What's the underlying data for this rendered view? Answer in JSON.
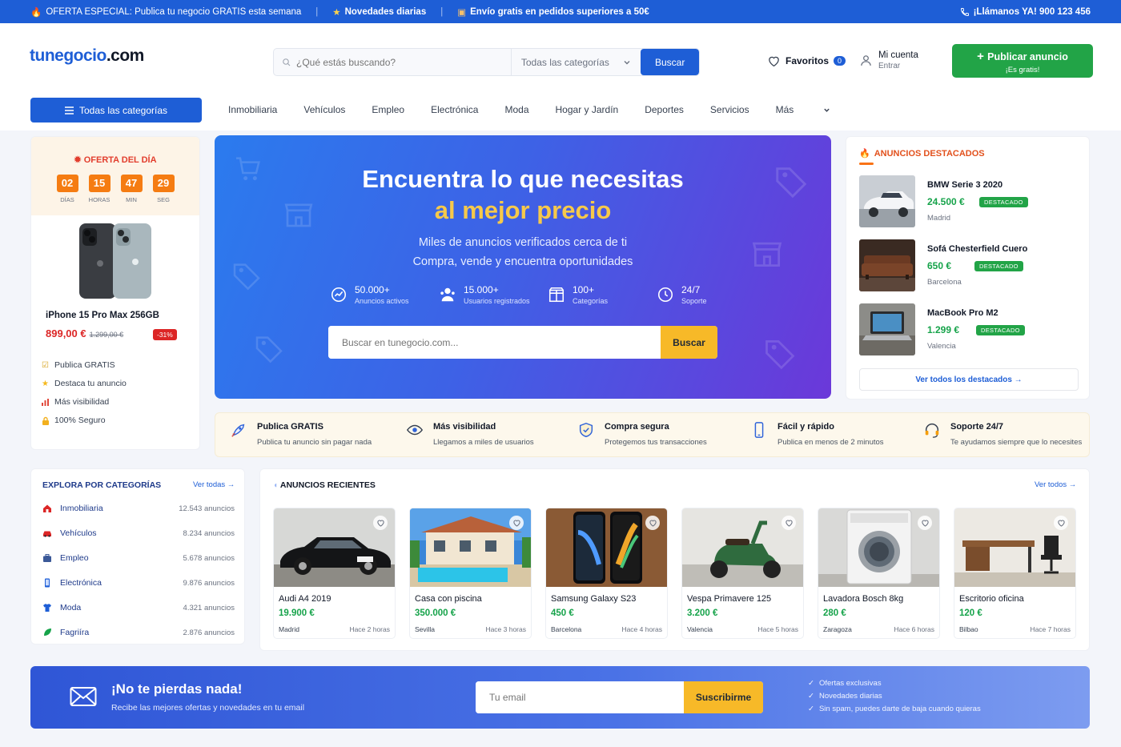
{
  "topbar": {
    "offer": "OFERTA ESPECIAL: Publica tu negocio GRATIS esta semana",
    "news": "Novedades diarias",
    "shipping": "Envío gratis en pedidos superiores a 50€",
    "phone": "¡Llámanos YA! 900 123 456"
  },
  "header": {
    "logo_main": "tunegocio",
    "logo_tld": ".com",
    "search_placeholder": "¿Qué estás buscando?",
    "category_select": "Todas las categorías",
    "search_button": "Buscar",
    "favorites_label": "Favoritos",
    "favorites_count": "0",
    "account_label": "Mi cuenta",
    "account_sub": "Entrar",
    "publish_label": "Publicar anuncio",
    "publish_sub": "¡Es gratis!"
  },
  "nav": {
    "all_categories": "Todas las categorías",
    "items": [
      "Inmobiliaria",
      "Vehículos",
      "Empleo",
      "Electrónica",
      "Moda",
      "Hogar y Jardín",
      "Deportes",
      "Servicios",
      "Más"
    ]
  },
  "deal": {
    "title": "OFERTA DEL DÍA",
    "countdown": [
      {
        "value": "02",
        "unit": "DÍAS"
      },
      {
        "value": "15",
        "unit": "HORAS"
      },
      {
        "value": "47",
        "unit": "MIN"
      },
      {
        "value": "29",
        "unit": "SEG"
      }
    ],
    "product": "iPhone 15 Pro Max 256GB",
    "price": "899,00 €",
    "old_price": "1.299,00 €",
    "discount": "-31%",
    "features": [
      "Publica GRATIS",
      "Destaca tu anuncio",
      "Más visibilidad",
      "100% Seguro"
    ]
  },
  "hero": {
    "title_line1": "Encuentra lo que necesitas",
    "title_line2": "al mejor precio",
    "subtitle1": "Miles de anuncios verificados cerca de ti",
    "subtitle2": "Compra, vende y encuentra oportunidades",
    "stats": [
      {
        "value": "50.000+",
        "label": "Anuncios activos",
        "icon": "chart-icon"
      },
      {
        "value": "15.000+",
        "label": "Usuarios registrados",
        "icon": "users-icon"
      },
      {
        "value": "100+",
        "label": "Categorías",
        "icon": "box-icon"
      },
      {
        "value": "24/7",
        "label": "Soporte",
        "icon": "clock-icon"
      }
    ],
    "search_placeholder": "Buscar en tunegocio.com...",
    "search_button": "Buscar"
  },
  "featured": {
    "title": "ANUNCIOS DESTACADOS",
    "tag": "DESTACADO",
    "items": [
      {
        "name": "BMW Serie 3 2020",
        "price": "24.500 €",
        "city": "Madrid"
      },
      {
        "name": "Sofá Chesterfield Cuero",
        "price": "650 €",
        "city": "Barcelona"
      },
      {
        "name": "MacBook Pro M2",
        "price": "1.299 €",
        "city": "Valencia"
      }
    ],
    "see_all": "Ver todos los destacados →"
  },
  "benefits": [
    {
      "title": "Publica GRATIS",
      "sub": "Publica tu anuncio sin pagar nada",
      "icon": "rocket-icon"
    },
    {
      "title": "Más visibilidad",
      "sub": "Llegamos a miles de usuarios",
      "icon": "eye-icon"
    },
    {
      "title": "Compra segura",
      "sub": "Protegemos tus transacciones",
      "icon": "shield-icon"
    },
    {
      "title": "Fácil y rápido",
      "sub": "Publica en menos de 2 minutos",
      "icon": "phone-icon"
    },
    {
      "title": "Soporte 24/7",
      "sub": "Te ayudamos siempre que lo necesites",
      "icon": "headset-icon"
    }
  ],
  "categories": {
    "title": "EXPLORA POR CATEGORÍAS",
    "see_all": "Ver todas →",
    "items": [
      {
        "name": "Inmobiliaria",
        "count": "12.543 anuncios",
        "color": "#dc2626"
      },
      {
        "name": "Vehículos",
        "count": "8.234 anuncios",
        "color": "#dc2626"
      },
      {
        "name": "Empleo",
        "count": "5.678 anuncios",
        "color": "#1e5ed6"
      },
      {
        "name": "Electrónica",
        "count": "9.876 anuncios",
        "color": "#1e5ed6"
      },
      {
        "name": "Moda",
        "count": "4.321 anuncios",
        "color": "#1e5ed6"
      },
      {
        "name": "Fagriíra",
        "count": "2.876 anuncios",
        "color": "#16a34a"
      }
    ]
  },
  "recent": {
    "title": "ANUNCIOS RECIENTES",
    "see_all": "Ver todos →",
    "items": [
      {
        "name": "Audi A4 2019",
        "price": "19.900 €",
        "city": "Madrid",
        "time": "Hace 2 horas"
      },
      {
        "name": "Casa con piscina",
        "price": "350.000 €",
        "city": "Sevilla",
        "time": "Hace 3 horas"
      },
      {
        "name": "Samsung Galaxy S23",
        "price": "450 €",
        "city": "Barcelona",
        "time": "Hace 4 horas"
      },
      {
        "name": "Vespa Primavere 125",
        "price": "3.200 €",
        "city": "Valencia",
        "time": "Hace 5 horas"
      },
      {
        "name": "Lavadora Bosch 8kg",
        "price": "280 €",
        "city": "Zaragoza",
        "time": "Hace 6 horas"
      },
      {
        "name": "Escritorio oficina",
        "price": "120 €",
        "city": "Bilbao",
        "time": "Hace 7 horas"
      }
    ]
  },
  "newsletter": {
    "title": "¡No te pierdas nada!",
    "subtitle": "Recibe las mejores ofertas y novedades en tu email",
    "placeholder": "Tu email",
    "button": "Suscribirme",
    "checks": [
      "Ofertas exclusivas",
      "Novedades diarias",
      "Sin spam, puedes darte de baja cuando quieras"
    ]
  },
  "colors": {
    "primary": "#1e5ed6",
    "success": "#22a447",
    "accent": "#f7b928",
    "danger": "#dc2626"
  }
}
